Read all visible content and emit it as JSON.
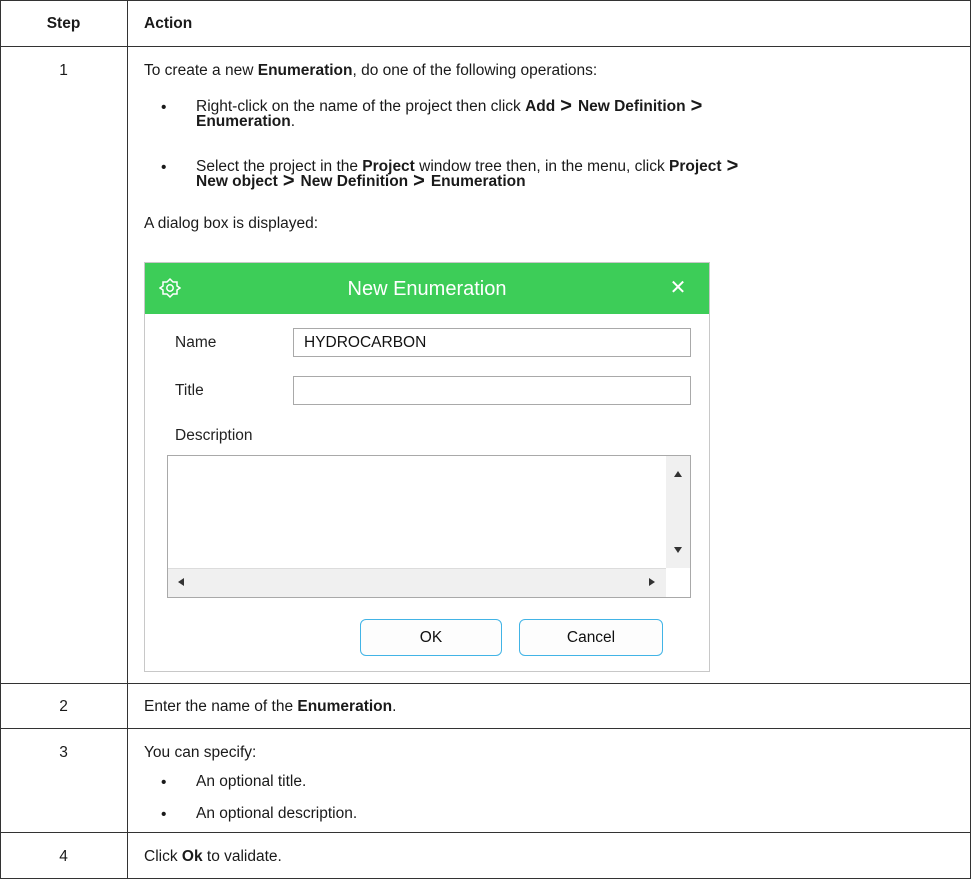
{
  "table": {
    "headers": {
      "step": "Step",
      "action": "Action"
    },
    "rows": [
      {
        "step": "1",
        "intro": {
          "pre": "To create a new ",
          "bold": "Enumeration",
          "post": ", do one of the following operations:"
        },
        "bullets": [
          {
            "line1_pre": "Right-click on the name of the project then click ",
            "add": "Add",
            "sep": ">",
            "new_def": "New Definition",
            "enum": "Enumeration",
            "end": "."
          },
          {
            "line1_pre": "Select the project in the ",
            "project_bold": "Project",
            "line1_mid": " window tree then, in the menu, click ",
            "project_menu": "Project",
            "sep": ">",
            "new_object": "New object",
            "new_def": "New Definition",
            "enum": "Enumeration"
          }
        ],
        "after": "A dialog box is displayed:"
      },
      {
        "step": "2",
        "pre": "Enter the name of the ",
        "bold": "Enumeration",
        "post": "."
      },
      {
        "step": "3",
        "text": "You can specify:",
        "bullets": [
          "An optional title.",
          "An optional description."
        ]
      },
      {
        "step": "4",
        "pre": "Click ",
        "bold": "Ok",
        "post": " to validate."
      }
    ],
    "bullet_char": "•"
  },
  "dialog": {
    "title": "New Enumeration",
    "close_glyph": "✕",
    "name_label": "Name",
    "name_value": "HYDROCARBON",
    "title_label": "Title",
    "title_value": "",
    "description_label": "Description",
    "description_value": "",
    "ok_label": "OK",
    "cancel_label": "Cancel",
    "title_bar_color": "#3dcd58",
    "button_border_color": "#42b4e6",
    "icon": "enumeration-app-icon"
  }
}
